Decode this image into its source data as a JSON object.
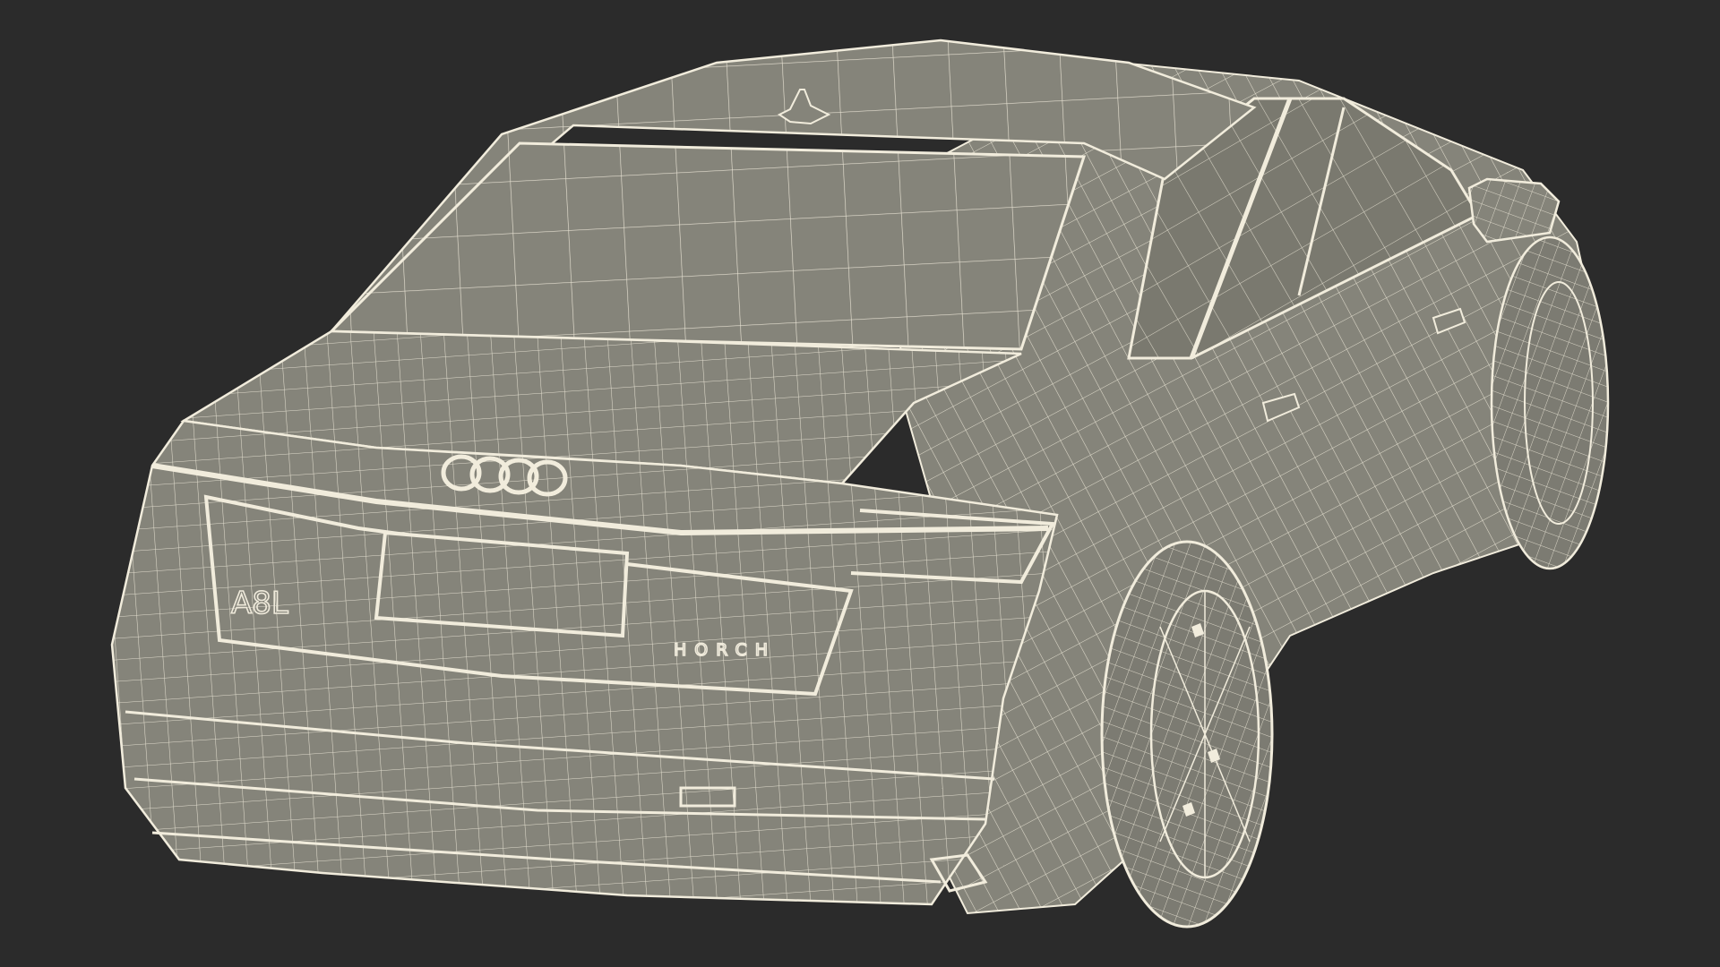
{
  "scene": {
    "background_color": "#2b2b2b",
    "surface_color": "#85847a",
    "wire_color": "#f1ecdc",
    "badges": {
      "model": "A8L",
      "sub_brand": "HORCH"
    }
  }
}
